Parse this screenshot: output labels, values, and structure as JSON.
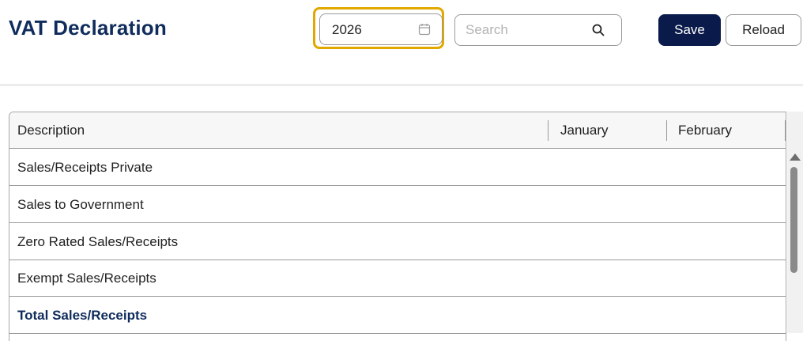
{
  "page": {
    "title": "VAT Declaration"
  },
  "toolbar": {
    "year_value": "2026",
    "search_placeholder": "Search",
    "save_label": "Save",
    "reload_label": "Reload",
    "icons": {
      "year": "calendar-icon",
      "search": "search-icon"
    },
    "colors": {
      "accent": "#0a1a4a",
      "focus": "#e0a800",
      "title": "#0f2c5c"
    }
  },
  "grid": {
    "columns": [
      "Description",
      "January",
      "February"
    ],
    "rows": [
      {
        "label": "Sales/Receipts Private",
        "total": false
      },
      {
        "label": "Sales to Government",
        "total": false
      },
      {
        "label": "Zero Rated Sales/Receipts",
        "total": false
      },
      {
        "label": "Exempt Sales/Receipts",
        "total": false
      },
      {
        "label": "Total Sales/Receipts",
        "total": true
      }
    ]
  }
}
